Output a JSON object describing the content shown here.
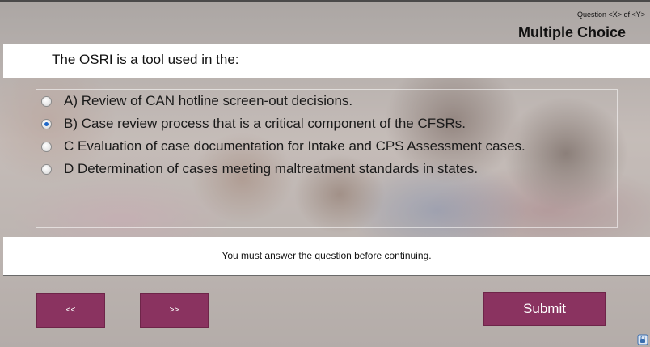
{
  "header": {
    "counter": "Question <X> of <Y>",
    "quiz_type": "Multiple Choice"
  },
  "question": {
    "text": "The OSRI is a tool used in the:"
  },
  "choices": [
    {
      "label": "A) Review of CAN hotline screen-out decisions.",
      "selected": false
    },
    {
      "label": "B) Case review process that is a critical component of the CFSRs.",
      "selected": true
    },
    {
      "label": "C Evaluation of case documentation for Intake and CPS Assessment cases.",
      "selected": false
    },
    {
      "label": "D Determination of cases meeting maltreatment standards in states.",
      "selected": false
    }
  ],
  "feedback": {
    "text": "You must answer the question before continuing."
  },
  "nav": {
    "prev_label": "<<",
    "next_label": ">>",
    "submit_label": "Submit"
  },
  "colors": {
    "button": "#8a3360",
    "radio_selected": "#1f67c8"
  },
  "icons": {
    "corner": "lock-icon"
  }
}
